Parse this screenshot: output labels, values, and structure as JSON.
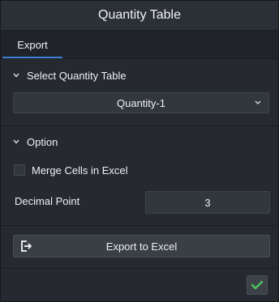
{
  "window": {
    "title": "Quantity Table"
  },
  "tabs": [
    {
      "label": "Export",
      "active": true
    }
  ],
  "select_section": {
    "header": "Select Quantity Table",
    "selected_value": "Quantity-1"
  },
  "option_section": {
    "header": "Option",
    "merge_cells_label": "Merge Cells in Excel",
    "merge_cells_checked": false,
    "decimal_point_label": "Decimal Point",
    "decimal_point_value": "3"
  },
  "export": {
    "button_label": "Export to Excel",
    "icon": "export-icon"
  },
  "footer": {
    "ok_icon": "check-icon"
  },
  "colors": {
    "accent_tab": "#3f7fd8",
    "check_green": "#4fc35a",
    "panel_bg": "#262a30"
  }
}
